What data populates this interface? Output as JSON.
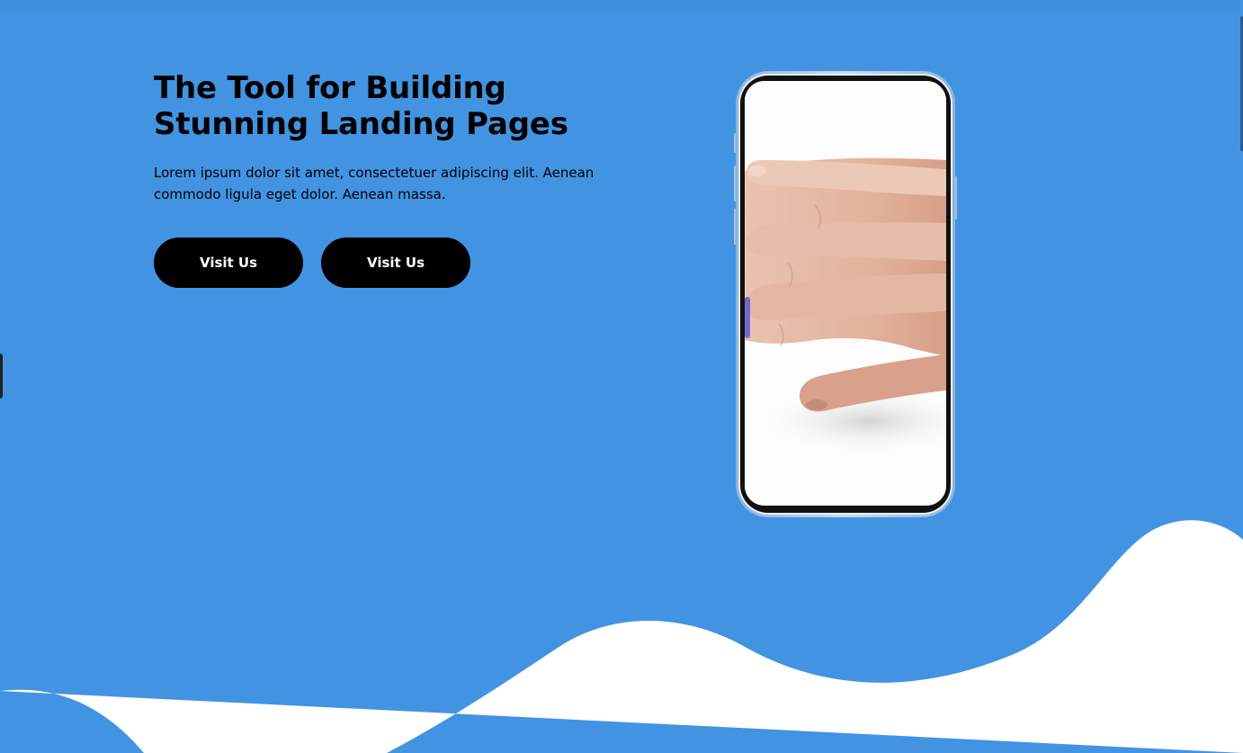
{
  "hero": {
    "title": "The Tool for Building Stunning Landing Pages",
    "description": "Lorem ipsum dolor sit amet, consectetuer adipiscing elit. Aenean commodo ligula eget dolor. Aenean massa.",
    "primary_button_label": "Visit Us",
    "secondary_button_label": "Visit Us"
  },
  "phone": {
    "screen_image": "hand-photo"
  },
  "colors": {
    "background": "#4294e2",
    "button": "#000000",
    "button_text": "#ffffff",
    "wave": "#ffffff"
  }
}
